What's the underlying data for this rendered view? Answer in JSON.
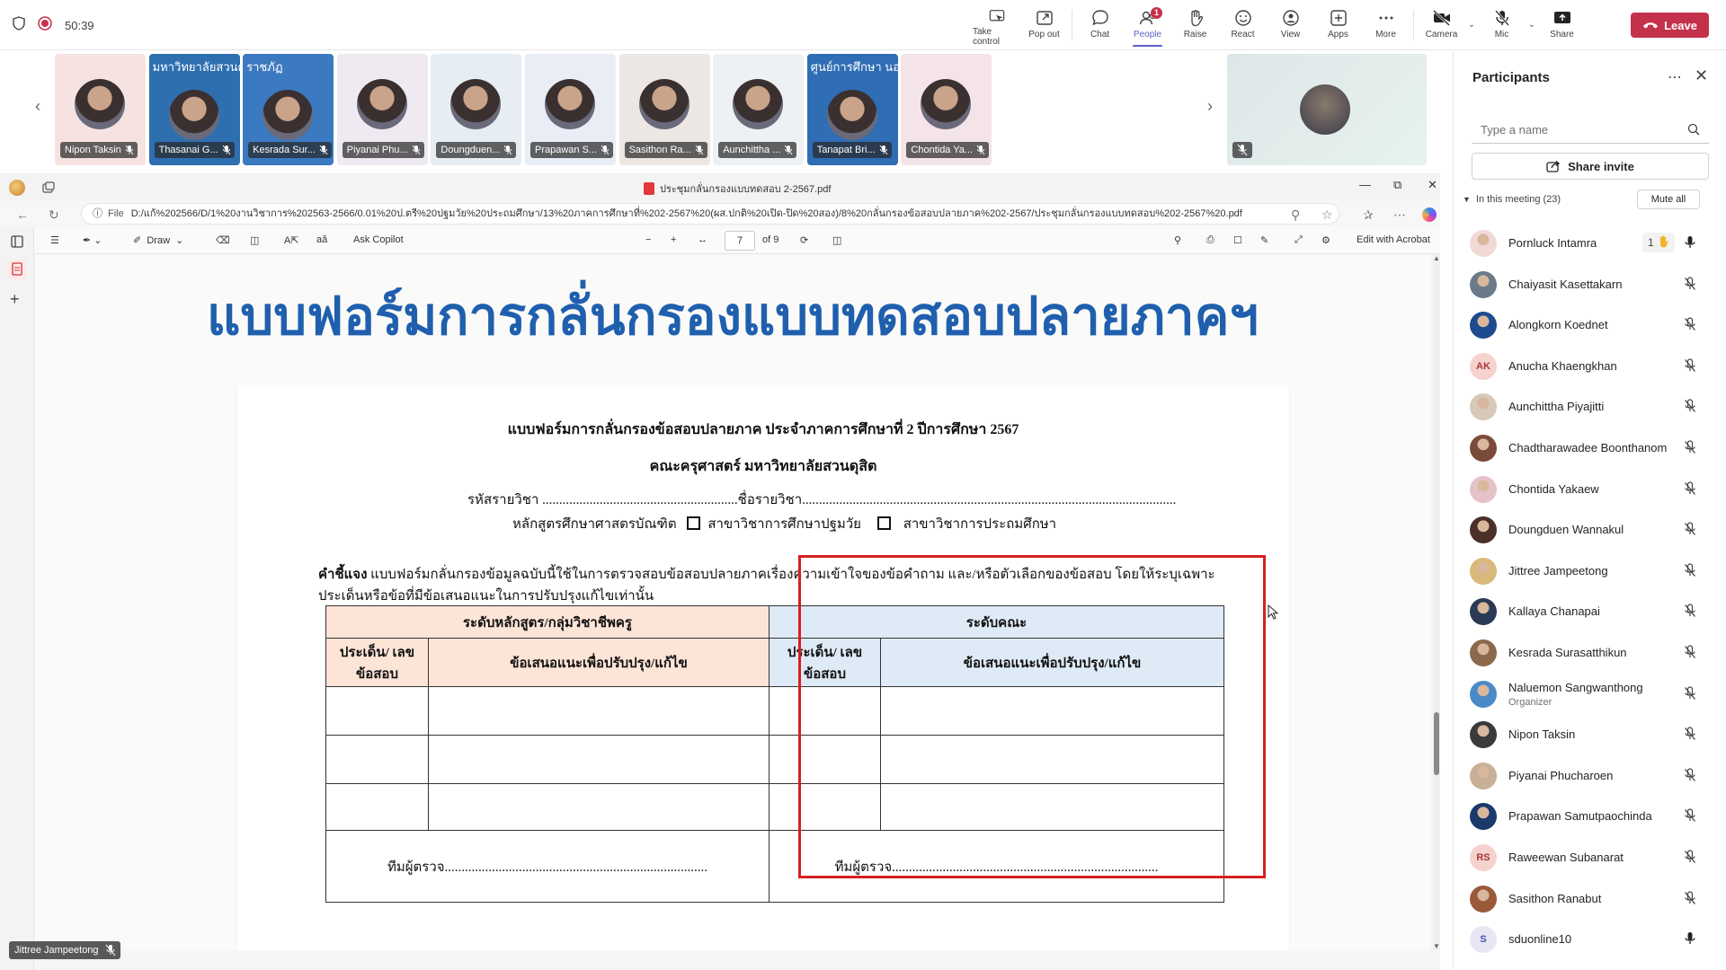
{
  "topbar": {
    "timer": "50:39",
    "tools": [
      {
        "label": "Take control",
        "icon": "take-control-icon"
      },
      {
        "label": "Pop out",
        "icon": "pop-out-icon"
      },
      {
        "label": "Chat",
        "icon": "chat-icon"
      },
      {
        "label": "People",
        "icon": "people-icon",
        "badge": "1",
        "active": true
      },
      {
        "label": "Raise",
        "icon": "raise-hand-icon"
      },
      {
        "label": "React",
        "icon": "react-icon"
      },
      {
        "label": "View",
        "icon": "view-icon"
      },
      {
        "label": "Apps",
        "icon": "apps-icon"
      },
      {
        "label": "More",
        "icon": "more-icon"
      },
      {
        "label": "Camera",
        "icon": "camera-off-icon"
      },
      {
        "label": "Mic",
        "icon": "mic-off-icon"
      },
      {
        "label": "Share",
        "icon": "share-icon"
      }
    ],
    "leave_label": "Leave",
    "leave_color": "#c4314b"
  },
  "video_tiles": [
    {
      "name": "Nipon Taksin",
      "bg": "#f6e3e1"
    },
    {
      "name": "Thasanai G...",
      "bg": "#2e6fb0",
      "banner": "มหาวิทยาลัยสวนดุสิต"
    },
    {
      "name": "Kesrada Sur...",
      "bg": "#3b79c0",
      "banner": "ราชภัฏ"
    },
    {
      "name": "Piyanai Phu...",
      "bg": "#efeaf2"
    },
    {
      "name": "Doungduen...",
      "bg": "#e6eef4"
    },
    {
      "name": "Prapawan S...",
      "bg": "#e9eef6"
    },
    {
      "name": "Sasithon Ra...",
      "bg": "#ede7e3"
    },
    {
      "name": "Aunchittha ...",
      "bg": "#eef1f4"
    },
    {
      "name": "Tanapat Bri...",
      "bg": "#2f6db4",
      "banner": "ศูนย์การศึกษา นอกสถาน"
    },
    {
      "name": "Chontida Ya...",
      "bg": "#f4e4ea"
    }
  ],
  "participants_panel": {
    "title": "Participants",
    "search_placeholder": "Type a name",
    "share_invite": "Share invite",
    "section_label": "In this meeting (23)",
    "mute_all": "Mute all",
    "people": [
      {
        "name": "Pornluck Intamra",
        "initials": "",
        "color": "#f1d9d6",
        "mic": "on",
        "raise": "1"
      },
      {
        "name": "Chaiyasit Kasettakarn",
        "initials": "",
        "color": "#6b7a8a",
        "mic": "off"
      },
      {
        "name": "Alongkorn Koednet",
        "initials": "",
        "color": "#1e4b8f",
        "mic": "off"
      },
      {
        "name": "Anucha Khaengkhan",
        "initials": "AK",
        "color": "#f6d2cf",
        "text_color": "#a4373a",
        "mic": "off"
      },
      {
        "name": "Aunchittha Piyajitti",
        "initials": "",
        "color": "#d8c8b8",
        "mic": "off"
      },
      {
        "name": "Chadtharawadee Boonthanom",
        "initials": "",
        "color": "#7a4a3a",
        "mic": "off"
      },
      {
        "name": "Chontida Yakaew",
        "initials": "",
        "color": "#e5c2c8",
        "mic": "off"
      },
      {
        "name": "Doungduen Wannakul",
        "initials": "",
        "color": "#4a3028",
        "mic": "off"
      },
      {
        "name": "Jittree Jampeetong",
        "initials": "",
        "color": "#d9b87a",
        "mic": "off"
      },
      {
        "name": "Kallaya Chanapai",
        "initials": "",
        "color": "#2a3a55",
        "mic": "off"
      },
      {
        "name": "Kesrada Surasatthikun",
        "initials": "",
        "color": "#8a6a4a",
        "mic": "off"
      },
      {
        "name": "Naluemon Sangwanthong",
        "subtitle": "Organizer",
        "initials": "",
        "color": "#4a8ac8",
        "mic": "off"
      },
      {
        "name": "Nipon Taksin",
        "initials": "",
        "color": "#3a3a3a",
        "mic": "off"
      },
      {
        "name": "Piyanai Phucharoen",
        "initials": "",
        "color": "#c8b098",
        "mic": "off"
      },
      {
        "name": "Prapawan Samutpaochinda",
        "initials": "",
        "color": "#1a3a6a",
        "mic": "off"
      },
      {
        "name": "Raweewan Subanarat",
        "initials": "RS",
        "color": "#f6d2cf",
        "text_color": "#a4373a",
        "mic": "off"
      },
      {
        "name": "Sasithon Ranabut",
        "initials": "",
        "color": "#9a5a3a",
        "mic": "off"
      },
      {
        "name": "sduonline10",
        "initials": "S",
        "color": "#e8e6f4",
        "text_color": "#4f52b2",
        "mic": "on"
      }
    ]
  },
  "pdf_window": {
    "title": "ประชุมกลั่นกรองแบบทดสอบ 2-2567.pdf",
    "address_prefix": "File",
    "address": "D:/แก้%202566/D/1%20งานวิชาการ%202563-2566/0.01%20ป.ตรี%20ปฐมวัย%20ประถมศึกษา/13%20ภาคการศึกษาที่%202-2567%20(ผส.ปกติ%20เปิด-ปิด%20สอง)/8%20กลั่นกรองข้อสอบปลายภาค%202-2567/ประชุมกลั่นกรองแบบทดสอบ%202-2567%20.pdf",
    "draw_label": "Draw",
    "copilot_label": "Ask Copilot",
    "page_current": "7",
    "page_total": "of 9",
    "edit_acrobat": "Edit with Acrobat"
  },
  "document": {
    "big_title": "แบบฟอร์มการกลั่นกรองแบบทดสอบปลายภาคฯ",
    "form_title": "แบบฟอร์มการกลั่นกรองข้อสอบปลายภาค ประจำภาคการศึกษาที่ 2 ปีการศึกษา 2567",
    "faculty": "คณะครุศาสตร์  มหาวิทยาลัยสวนดุสิต",
    "course_line": "รหัสรายวิชา ..........................................................ชื่อรายวิชา...............................................................................................................",
    "program_label": "หลักสูตรศึกษาศาสตรบัณฑิต",
    "option_1": "สาขาวิชาการศึกษาปฐมวัย",
    "option_2": "สาขาวิชาการประถมศึกษา",
    "instruction_label": "คำชี้แจง",
    "instruction_text": " แบบฟอร์มกลั่นกรองข้อมูลฉบับนี้ใช้ในการตรวจสอบข้อสอบปลายภาคเรื่องความเข้าใจของข้อคำถาม และ/หรือตัวเลือกของข้อสอบ โดยให้ระบุเฉพาะประเด็นหรือข้อที่มีข้อเสนอแนะในการปรับปรุงแก้ไขเท่านั้น",
    "table": {
      "left_header": "ระดับหลักสูตร/กลุ่มวิชาชีพครู",
      "right_header": "ระดับคณะ",
      "col_issue": "ประเด็น/ เลขข้อสอบ",
      "col_suggest": "ข้อเสนอแนะเพื่อปรับปรุง/แก้ไข",
      "signature_left": "ทีมผู้ตรวจ..............................................................................",
      "signature_right": "ทีมผู้ตรวจ..............................................................................."
    },
    "highlight_color": "#d62020"
  },
  "presenter": "Jittree Jampeetong"
}
